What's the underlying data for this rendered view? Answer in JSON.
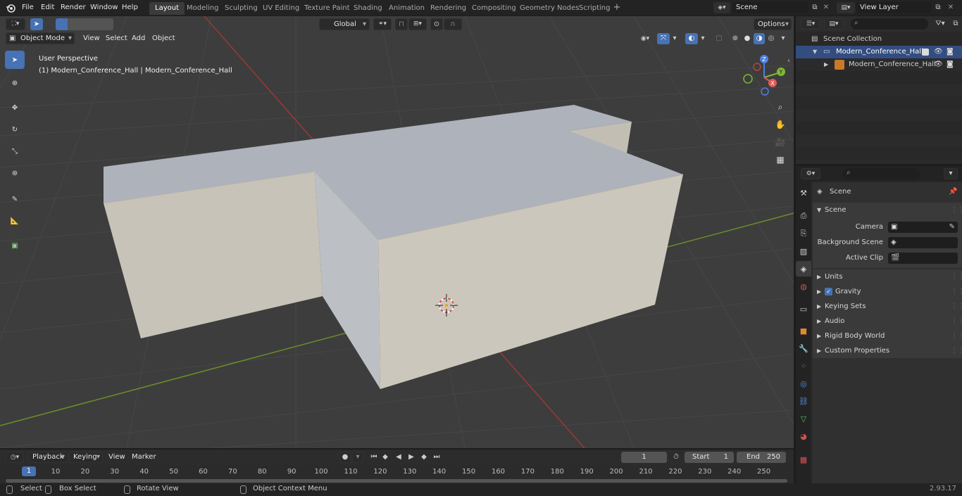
{
  "app": {
    "version": "2.93.17"
  },
  "menus": [
    "File",
    "Edit",
    "Render",
    "Window",
    "Help"
  ],
  "workspaces": [
    "Layout",
    "Modeling",
    "Sculpting",
    "UV Editing",
    "Texture Paint",
    "Shading",
    "Animation",
    "Rendering",
    "Compositing",
    "Geometry Nodes",
    "Scripting"
  ],
  "active_workspace": "Layout",
  "scene_field": "Scene",
  "view_layer_field": "View Layer",
  "viewport": {
    "transform_orientation": "Global",
    "options_label": "Options",
    "mode": "Object Mode",
    "menus": [
      "View",
      "Select",
      "Add",
      "Object"
    ],
    "overlay_line1": "User Perspective",
    "overlay_line2": "(1) Modern_Conference_Hall | Modern_Conference_Hall",
    "gizmo_labels": {
      "x": "X",
      "y": "Y",
      "z": "Z"
    }
  },
  "outliner": {
    "scene_collection": "Scene Collection",
    "items": [
      {
        "label": "Modern_Conference_Hall",
        "type": "collection"
      },
      {
        "label": "Modern_Conference_Hall",
        "type": "mesh"
      }
    ]
  },
  "properties": {
    "context_label": "Scene",
    "panel_title": "Scene",
    "fields": [
      {
        "label": "Camera"
      },
      {
        "label": "Background Scene"
      },
      {
        "label": "Active Clip"
      }
    ],
    "collapsed_panels": [
      "Units",
      "Gravity",
      "Keying Sets",
      "Audio",
      "Rigid Body World",
      "Custom Properties"
    ],
    "gravity_checked": true
  },
  "timeline": {
    "menus": [
      "Playback",
      "Keying",
      "View",
      "Marker"
    ],
    "current_frame": "1",
    "start_label": "Start",
    "start_value": "1",
    "end_label": "End",
    "end_value": "250",
    "ruler_current": "1",
    "ticks": [
      "10",
      "20",
      "30",
      "40",
      "50",
      "60",
      "70",
      "80",
      "90",
      "100",
      "110",
      "120",
      "130",
      "140",
      "150",
      "160",
      "170",
      "180",
      "190",
      "200",
      "210",
      "220",
      "230",
      "240",
      "250"
    ]
  },
  "statusbar": {
    "items": [
      "Select",
      "Box Select",
      "Rotate View",
      "Object Context Menu"
    ]
  },
  "colors": {
    "accent": "#4772b3",
    "viewport_bg": "#3d3d3d",
    "object_top": "#aeb3bc",
    "object_side": "#c9c4b9"
  }
}
